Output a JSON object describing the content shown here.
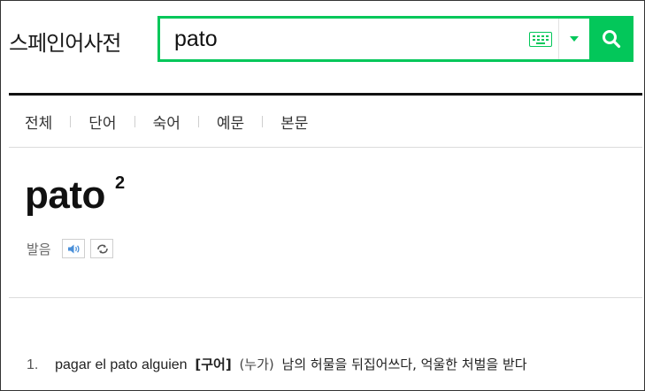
{
  "header": {
    "site_title": "스페인어사전",
    "search": {
      "value": "pato",
      "placeholder": ""
    },
    "keyboard_icon": "keyboard-icon",
    "dropdown_icon": "caret-down-icon",
    "search_icon": "search-icon"
  },
  "tabs": [
    {
      "label": "전체"
    },
    {
      "label": "단어"
    },
    {
      "label": "숙어"
    },
    {
      "label": "예문"
    },
    {
      "label": "본문"
    }
  ],
  "entry": {
    "word": "pato",
    "superscript": "2",
    "pronunciation_label": "발음"
  },
  "definitions": [
    {
      "number": "1.",
      "phrase": "pagar el pato alguien",
      "tag": "[구어]",
      "subject": "(누가)",
      "meaning": "남의 허물을 뒤집어쓰다, 억울한 처벌을 받다"
    }
  ],
  "colors": {
    "accent": "#03c75a",
    "text": "#222222",
    "divider": "#dcdcdc"
  }
}
